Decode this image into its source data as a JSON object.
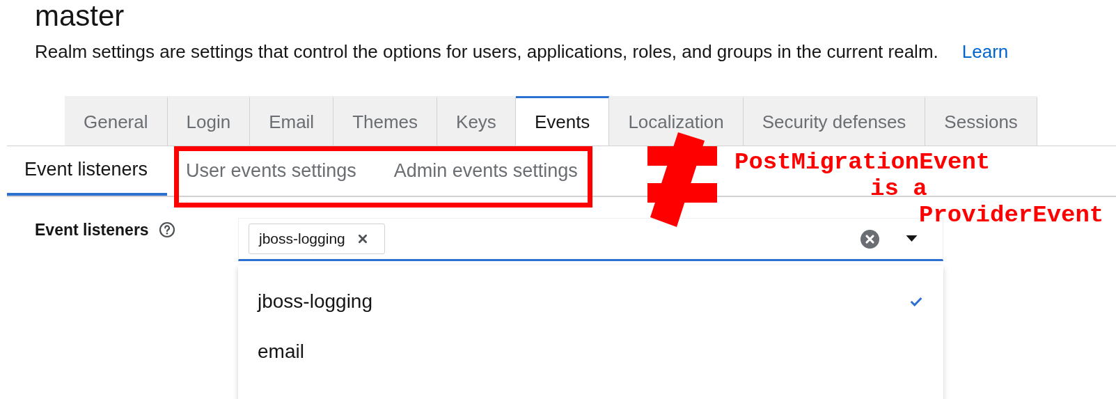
{
  "page": {
    "title": "master",
    "description": "Realm settings are settings that control the options for users, applications, roles, and groups in the current realm.",
    "learn_more_link": "Learn"
  },
  "tabs": [
    {
      "label": "General",
      "selected": false
    },
    {
      "label": "Login",
      "selected": false
    },
    {
      "label": "Email",
      "selected": false
    },
    {
      "label": "Themes",
      "selected": false
    },
    {
      "label": "Keys",
      "selected": false
    },
    {
      "label": "Events",
      "selected": true
    },
    {
      "label": "Localization",
      "selected": false
    },
    {
      "label": "Security defenses",
      "selected": false
    },
    {
      "label": "Sessions",
      "selected": false
    }
  ],
  "subtabs": [
    {
      "label": "Event listeners",
      "selected": true,
      "highlighted": false
    },
    {
      "label": "User events settings",
      "selected": false,
      "highlighted": true
    },
    {
      "label": "Admin events settings",
      "selected": false,
      "highlighted": true
    }
  ],
  "field": {
    "label": "Event listeners",
    "chips": [
      {
        "label": "jboss-logging"
      }
    ],
    "menu_items": [
      {
        "label": "jboss-logging",
        "selected": true
      },
      {
        "label": "email",
        "selected": false
      }
    ]
  },
  "annotation": {
    "lines": [
      "PostMigrationEvent",
      "is a",
      "ProviderEvent"
    ]
  }
}
